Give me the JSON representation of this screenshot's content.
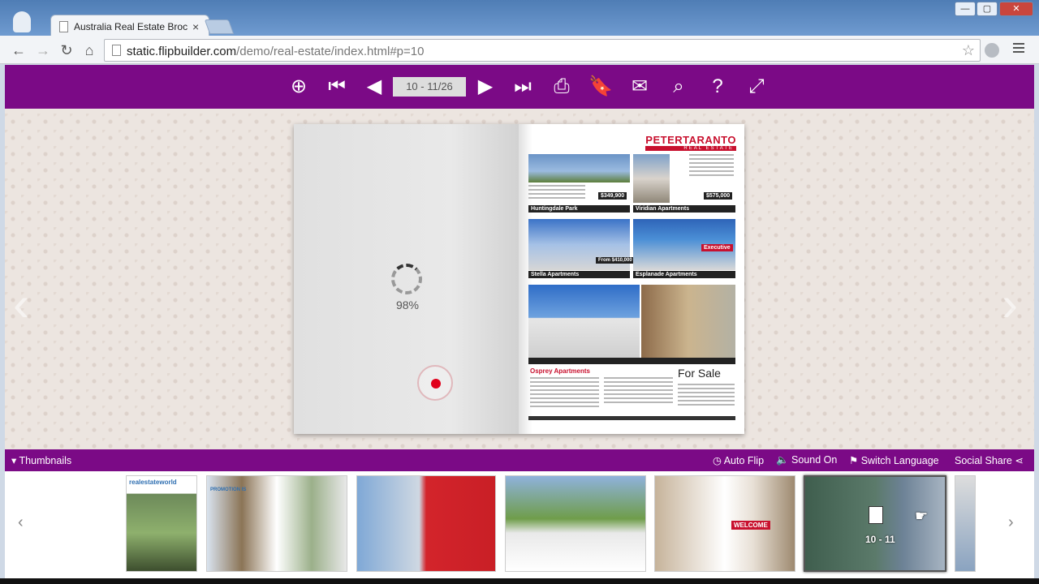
{
  "browser": {
    "tab_title": "Australia Real Estate Broch",
    "tab_close": "×",
    "url_host": "static.flipbuilder.com",
    "url_path": "/demo/real-estate/index.html#p=10",
    "window_controls": {
      "minimize": "—",
      "maximize": "▢",
      "close": "✕"
    }
  },
  "flipbook": {
    "page_indicator": "10 - 11/26",
    "loading_progress": "98%",
    "right_page": {
      "brand_name": "PETERTARANTO",
      "brand_sub": "REAL ESTATE",
      "listings": [
        {
          "name": "Huntingdale Park",
          "price": "$349,900"
        },
        {
          "name": "Viridian Apartments",
          "price": "$575,000"
        },
        {
          "name": "Stella Apartments",
          "price": "From $410,000"
        },
        {
          "name": "Esplanade Apartments",
          "price": ""
        }
      ],
      "feature_title": "Osprey Apartments",
      "for_sale": "For Sale",
      "badge_exec": "Executive"
    }
  },
  "bottom_bar": {
    "thumbnails_label": "Thumbnails",
    "auto_flip": "Auto Flip",
    "sound": "Sound On",
    "switch_language": "Switch Language",
    "social_share": "Social Share"
  },
  "thumbnails": {
    "active_label": "10 - 11",
    "items": [
      {
        "brand": "realestateworld"
      },
      {
        "title": "PROMOTION IS"
      },
      {
        "title": ""
      },
      {
        "title": ""
      },
      {
        "title": "WELCOME"
      },
      {
        "title": "10 - 11"
      }
    ]
  },
  "colors": {
    "toolbar": "#7b0a86",
    "accent_red": "#c8102e"
  }
}
